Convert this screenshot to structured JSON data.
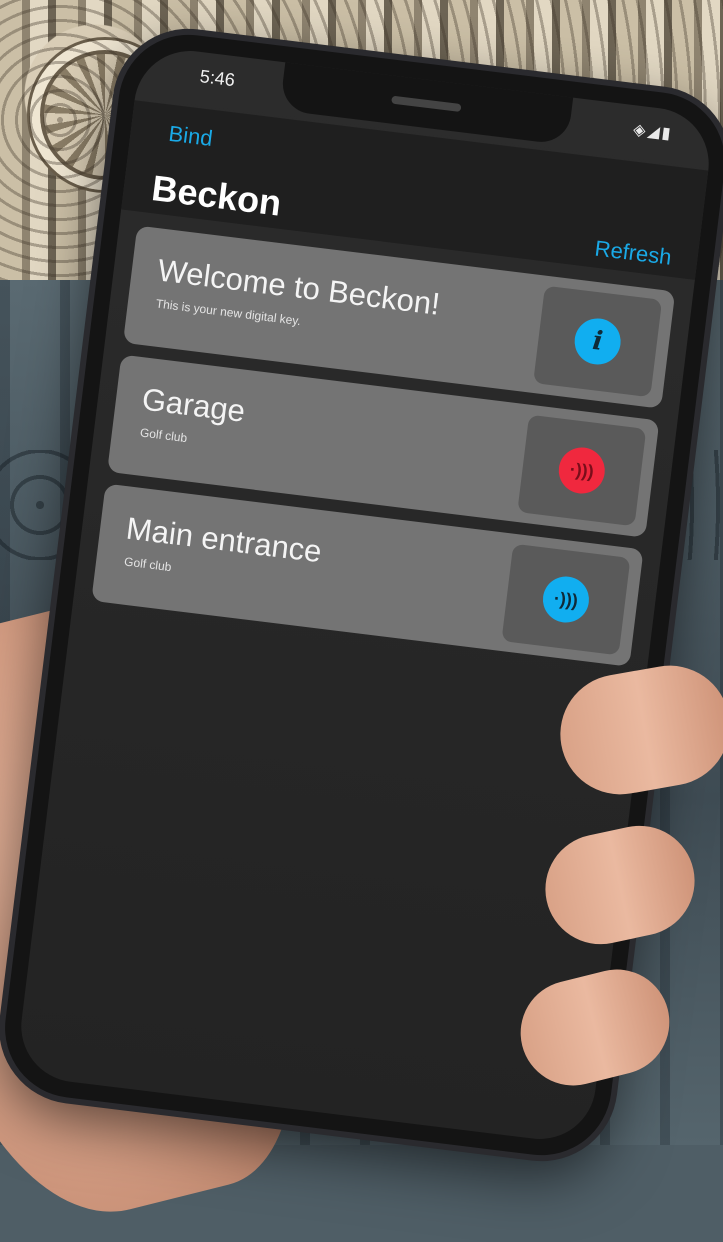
{
  "status": {
    "time": "5:46"
  },
  "nav": {
    "bind_label": "Bind",
    "title": "Beckon",
    "refresh_label": "Refresh"
  },
  "cards": [
    {
      "title": "Welcome to Beckon!",
      "subtitle": "This is your new digital key.",
      "icon": "info-icon",
      "icon_color": "#11aef0"
    },
    {
      "title": "Garage",
      "subtitle": "Golf club",
      "icon": "nfc-icon",
      "icon_color": "#f0283e"
    },
    {
      "title": "Main entrance",
      "subtitle": "Golf club",
      "icon": "nfc-icon",
      "icon_color": "#11aef0"
    }
  ],
  "colors": {
    "accent": "#1aa9e6",
    "card": "#747474",
    "background": "#262626"
  }
}
